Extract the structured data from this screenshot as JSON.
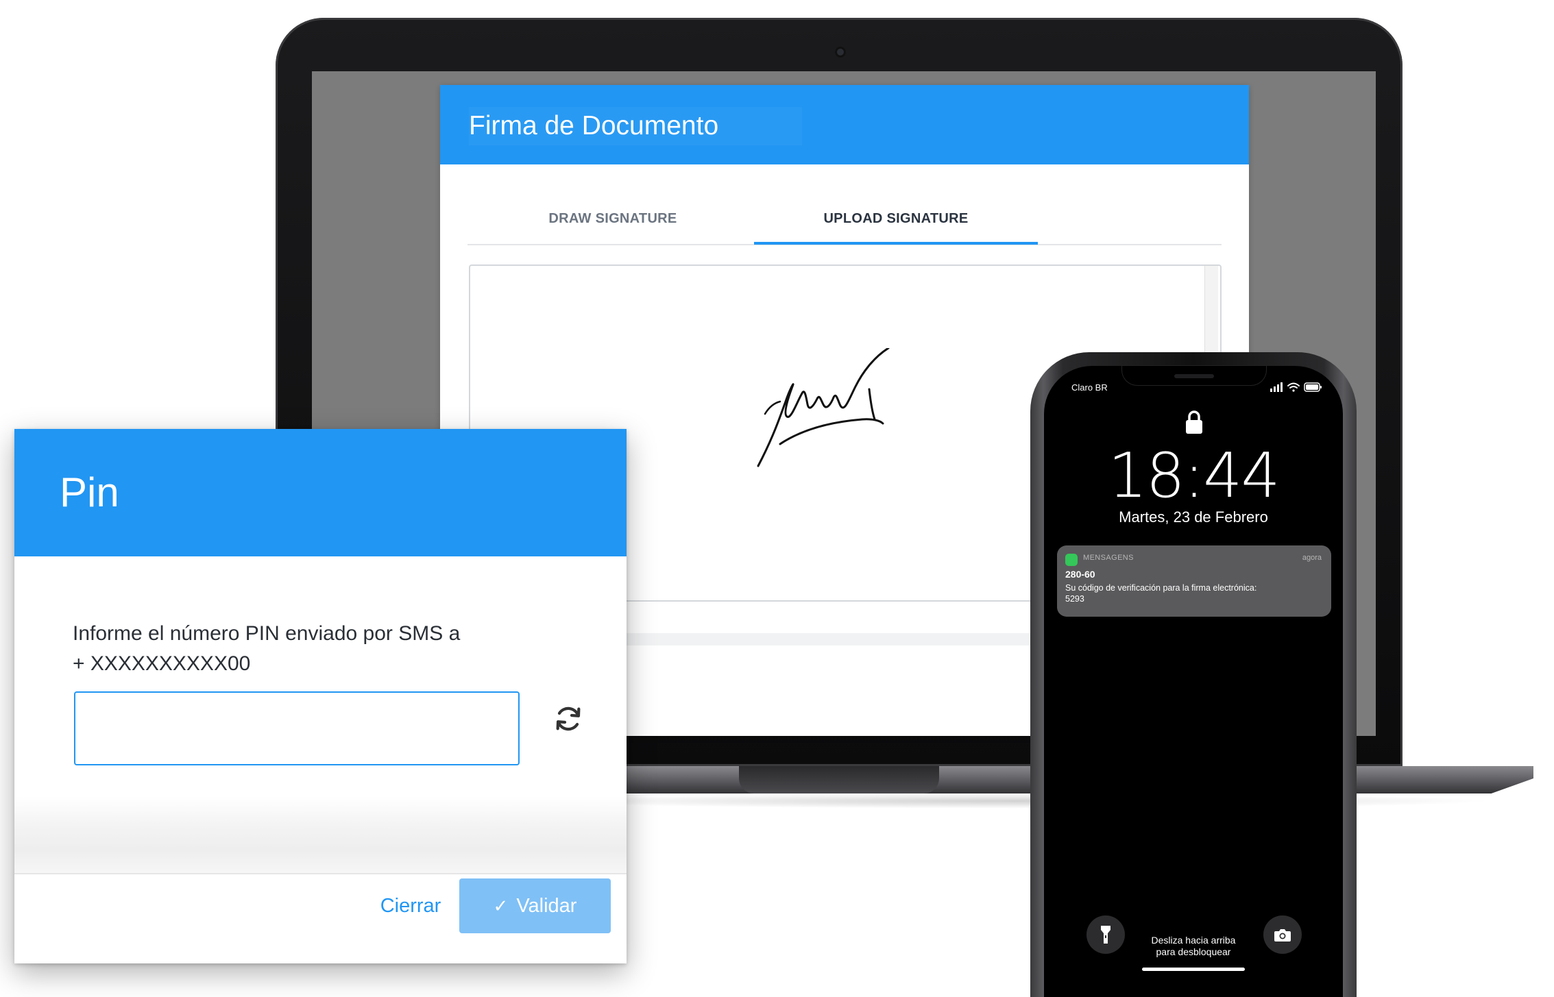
{
  "signature_window": {
    "title": "Firma de Documento",
    "tabs": [
      {
        "label": "DRAW SIGNATURE",
        "active": false
      },
      {
        "label": "UPLOAD SIGNATURE",
        "active": true
      }
    ]
  },
  "pin_dialog": {
    "title": "Pin",
    "instruction_line1": "Informe el número PIN enviado por SMS a",
    "instruction_line2": "+ XXXXXXXXXX00",
    "input_value": "",
    "refresh_icon": "refresh-icon",
    "cancel_label": "Cierrar",
    "validate_label": "Validar",
    "validate_icon": "check-icon"
  },
  "phone": {
    "carrier": "Claro BR",
    "time": "18:44",
    "date": "Martes, 23 de Febrero",
    "notification": {
      "app": "MENSAGENS",
      "time": "agora",
      "sender": "280-60",
      "body": "Su código de verificación para la firma electrónica: 5293"
    },
    "unlock_hint_line1": "Desliza hacia arriba",
    "unlock_hint_line2": "para desbloquear"
  },
  "colors": {
    "brand_blue": "#2196f3",
    "validate_disabled": "#7fc0f6"
  }
}
